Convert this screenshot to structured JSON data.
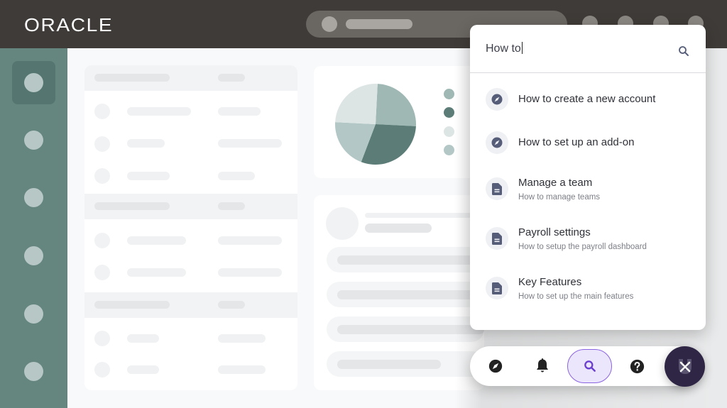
{
  "header": {
    "logo_text": "ORACLE"
  },
  "search_panel": {
    "query": "How to",
    "search_icon": "search-icon",
    "results": [
      {
        "icon": "compass-icon",
        "title": "How to create a new account",
        "subtitle": ""
      },
      {
        "icon": "compass-icon",
        "title": "How to set up an add-on",
        "subtitle": ""
      },
      {
        "icon": "document-icon",
        "title": "Manage a team",
        "subtitle": "How to manage teams"
      },
      {
        "icon": "document-icon",
        "title": "Payroll settings",
        "subtitle": "How to setup the payroll dashboard"
      },
      {
        "icon": "document-icon",
        "title": "Key Features",
        "subtitle": "How to set up the main features"
      }
    ]
  },
  "dock": {
    "items": [
      {
        "icon": "compass-icon",
        "active": false
      },
      {
        "icon": "bell-icon",
        "active": false
      },
      {
        "icon": "search-icon",
        "active": true
      },
      {
        "icon": "help-icon",
        "active": false
      }
    ],
    "close_icon": "close-icon"
  },
  "colors": {
    "topbar": "#3f3b38",
    "sidebar": "#65857f",
    "accent": "#8a63e0",
    "fab": "#2f2545",
    "icon": "#555d78"
  },
  "placeholder_pie": {
    "slices": [
      {
        "share": 0.25,
        "color": "#9fb8b4"
      },
      {
        "share": 0.3,
        "color": "#5c7d77"
      },
      {
        "share": 0.2,
        "color": "#b3c8c6"
      },
      {
        "share": 0.25,
        "color": "#dde5e4"
      }
    ]
  }
}
